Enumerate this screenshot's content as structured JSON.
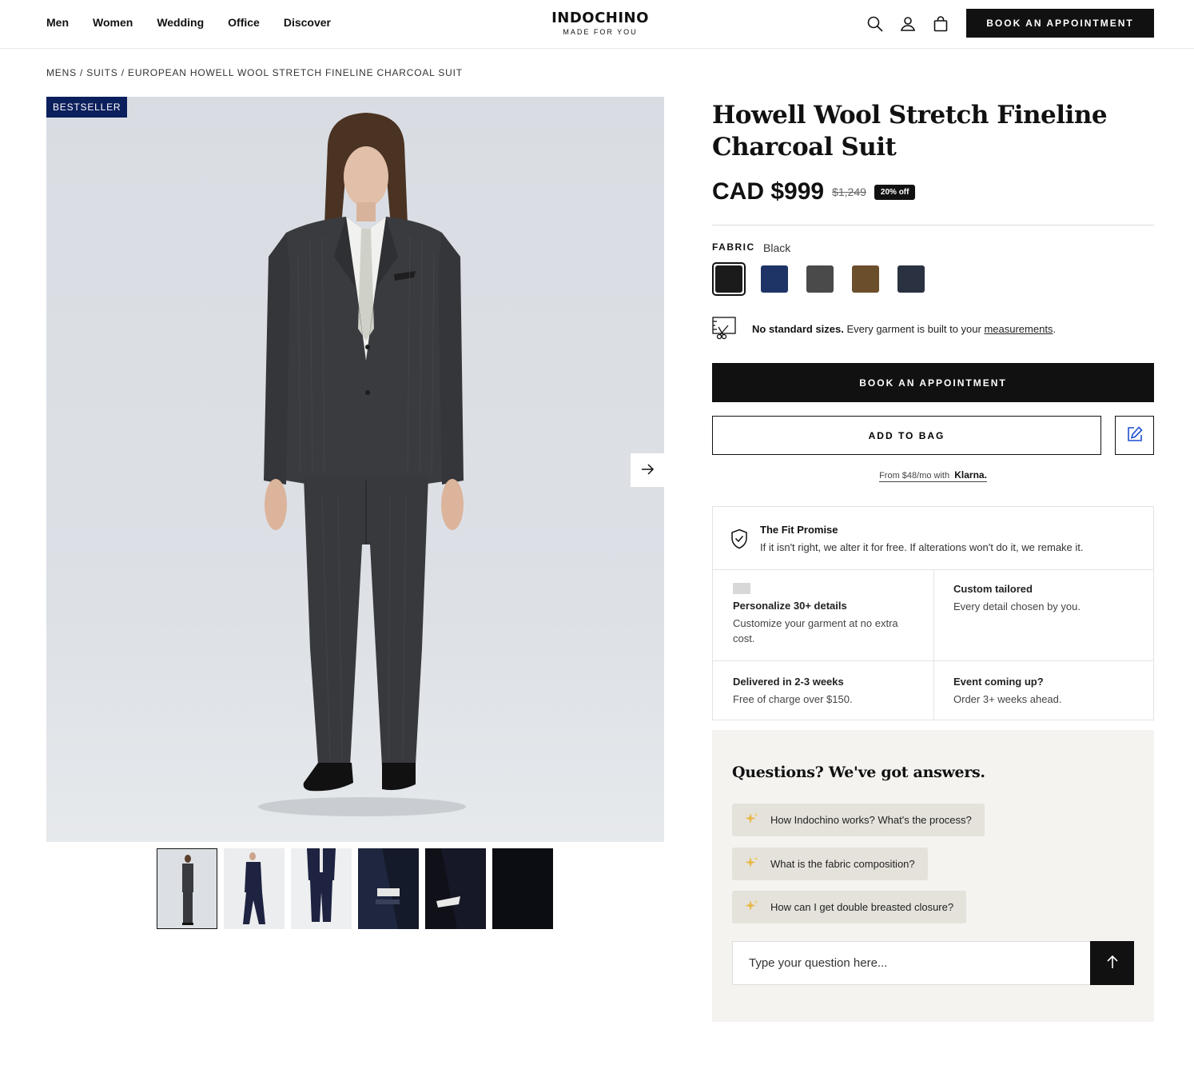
{
  "nav": {
    "items": [
      "Men",
      "Women",
      "Wedding",
      "Office",
      "Discover"
    ]
  },
  "logo": {
    "brand": "INDOCHINO",
    "tagline": "MADE FOR YOU"
  },
  "header": {
    "icons": [
      "search-icon",
      "account-icon",
      "bag-icon"
    ],
    "book_label": "BOOK AN APPOINTMENT"
  },
  "breadcrumb": "MENS / SUITS / EUROPEAN HOWELL WOOL STRETCH FINELINE CHARCOAL SUIT",
  "gallery": {
    "badge": "BESTSELLER",
    "thumb_count": 6,
    "selected_thumb": 1
  },
  "product": {
    "title": "Howell Wool Stretch Fineline Charcoal Suit",
    "price": "CAD $999",
    "old_price": "$1,249",
    "discount": "20% off"
  },
  "fabric": {
    "label": "FABRIC",
    "selected": "Black",
    "swatches": [
      {
        "name": "Black",
        "color": "#1b1b1b"
      },
      {
        "name": "Navy",
        "color": "#1f3466"
      },
      {
        "name": "Charcoal",
        "color": "#4a4a4a"
      },
      {
        "name": "Brown",
        "color": "#6b4f2c"
      },
      {
        "name": "Dark Navy",
        "color": "#2a3140"
      }
    ]
  },
  "sizes": {
    "bold": "No standard sizes.",
    "text": " Every garment is built to your ",
    "link": "measurements",
    "end": "."
  },
  "actions": {
    "book_label": "BOOK AN APPOINTMENT",
    "add_label": "ADD TO BAG",
    "klarna_text": "From $48/mo with",
    "klarna_brand": "Klarna."
  },
  "features": {
    "fit_title": "The Fit Promise",
    "fit_text": "If it isn't right, we alter it for free. If alterations won't do it, we remake it.",
    "cells": [
      {
        "title": "Personalize 30+ details",
        "text": "Customize your garment at no extra cost."
      },
      {
        "title": "Custom tailored",
        "text": "Every detail chosen by you."
      },
      {
        "title": "Delivered in 2-3 weeks",
        "text": "Free of charge over $150."
      },
      {
        "title": "Event coming up?",
        "text": "Order 3+ weeks ahead."
      }
    ]
  },
  "qa": {
    "title": "Questions? We've got answers.",
    "questions": [
      "How Indochino works? What's the process?",
      "What is the fabric composition?",
      "How can I get double breasted closure?"
    ],
    "placeholder": "Type your question here..."
  },
  "colors": {
    "accent": "#111111",
    "badge": "#0b1f5c",
    "qa_bg": "#f4f3ef",
    "chip_bg": "#e5e2db",
    "spark": "#e8b84a"
  }
}
